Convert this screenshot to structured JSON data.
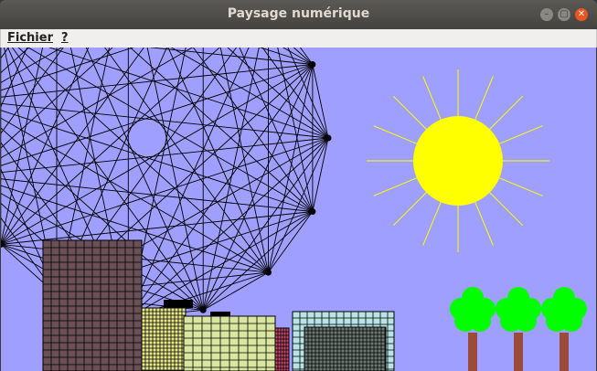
{
  "window": {
    "title": "Paysage numérique",
    "controls": {
      "minimize": "–",
      "maximize": "▢",
      "close": "✕"
    }
  },
  "menubar": {
    "items": [
      {
        "label": "Fichier"
      },
      {
        "label": "?"
      }
    ]
  },
  "scene": {
    "colors": {
      "sky": "#9f9fff",
      "sun": "#ffff00",
      "rays": "#ffff00",
      "polygon_lines": "#000000",
      "tree_foliage": "#00ff00",
      "tree_trunk": "#9a4b3a",
      "building_1": "#6a4f57",
      "building_2": "#e6e88a",
      "building_3": "#d9e6a0",
      "building_4": "#c84a6a",
      "building_5": "#b8e4e4",
      "building_5_door": "#6c7a72"
    },
    "polygon_vertex_count": 15,
    "tree_count": 3,
    "sun_ray_count": 16
  }
}
